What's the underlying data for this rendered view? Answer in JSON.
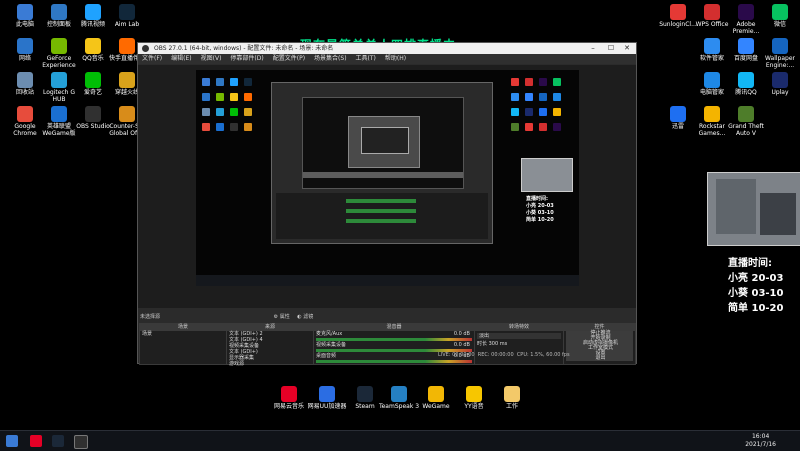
{
  "desktop_left": [
    {
      "label": "此电脑",
      "color": "#3a7bd5",
      "col": 0,
      "row": 0
    },
    {
      "label": "控制面板",
      "color": "#2f78c4",
      "col": 1,
      "row": 0
    },
    {
      "label": "腾讯视频",
      "color": "#1fa2ff",
      "col": 2,
      "row": 0
    },
    {
      "label": "Aim Lab",
      "color": "#11273a",
      "col": 3,
      "row": 0
    },
    {
      "label": "网络",
      "color": "#2a74c9",
      "col": 0,
      "row": 1
    },
    {
      "label": "GeForce Experience",
      "color": "#76b900",
      "col": 1,
      "row": 1
    },
    {
      "label": "QQ音乐",
      "color": "#f5c518",
      "col": 2,
      "row": 1
    },
    {
      "label": "快手直播伴侣",
      "color": "#ff6a00",
      "col": 3,
      "row": 1
    },
    {
      "label": "回收站",
      "color": "#6c8db0",
      "col": 0,
      "row": 2
    },
    {
      "label": "Logitech G HUB",
      "color": "#24a0d8",
      "col": 1,
      "row": 2
    },
    {
      "label": "爱奇艺",
      "color": "#00be06",
      "col": 2,
      "row": 2
    },
    {
      "label": "穿越火线",
      "color": "#d9a21b",
      "col": 3,
      "row": 2
    },
    {
      "label": "Google Chrome",
      "color": "#e74c3c",
      "col": 0,
      "row": 3
    },
    {
      "label": "英雄联盟WeGame版",
      "color": "#1a6fd1",
      "col": 1,
      "row": 3
    },
    {
      "label": "OBS Studio",
      "color": "#303030",
      "col": 2,
      "row": 3
    },
    {
      "label": "Counter-S... Global Off...",
      "color": "#d88c1a",
      "col": 3,
      "row": 3
    }
  ],
  "desktop_right": [
    {
      "label": "SunloginCl...",
      "color": "#e53935",
      "col": 0,
      "row": 0
    },
    {
      "label": "WPS Office",
      "color": "#d32f2f",
      "col": 1,
      "row": 0
    },
    {
      "label": "Adobe Premie...",
      "color": "#2a0a4a",
      "col": 2,
      "row": 0
    },
    {
      "label": "微信",
      "color": "#07c160",
      "col": 3,
      "row": 0
    },
    {
      "label": "软件管家",
      "color": "#2d8cf0",
      "col": 1,
      "row": 1
    },
    {
      "label": "百度网盘",
      "color": "#3385ff",
      "col": 2,
      "row": 1
    },
    {
      "label": "Wallpaper Engine:...",
      "color": "#1565c0",
      "col": 3,
      "row": 1
    },
    {
      "label": "电脑管家",
      "color": "#1e88e5",
      "col": 1,
      "row": 2
    },
    {
      "label": "腾讯QQ",
      "color": "#12b7f5",
      "col": 2,
      "row": 2
    },
    {
      "label": "Uplay",
      "color": "#1a2a6c",
      "col": 3,
      "row": 2
    },
    {
      "label": "迅雷",
      "color": "#1e6ff1",
      "col": 0,
      "row": 3
    },
    {
      "label": "Rockstar Games...",
      "color": "#f4b400",
      "col": 1,
      "row": 3
    },
    {
      "label": "Grand Theft Auto V",
      "color": "#4e7d2a",
      "col": 2,
      "row": 3
    }
  ],
  "desktop_bottom": [
    {
      "label": "网易云音乐",
      "color": "#e60026"
    },
    {
      "label": "网易UU加速器",
      "color": "#2b6de3"
    },
    {
      "label": "Steam",
      "color": "#1b2838"
    },
    {
      "label": "TeamSpeak 3",
      "color": "#2580c3"
    },
    {
      "label": "WeGame",
      "color": "#f2b705"
    },
    {
      "label": "YY语音",
      "color": "#f7c600"
    },
    {
      "label": "工作",
      "color": "#f3c969"
    }
  ],
  "stream_title": "现在是简单单人四排直播中",
  "obs": {
    "title": "OBS 27.0.1 (64-bit, windows) - 配置文件: 未命名 - 场景: 未命名",
    "menu": [
      "文件(F)",
      "编辑(E)",
      "视图(V)",
      "停靠部件(D)",
      "配置文件(P)",
      "场景集合(S)",
      "工具(T)",
      "帮助(H)"
    ],
    "scene_bar_label": "未选择源",
    "scene_bar_props": "属性",
    "scene_bar_filters": "滤镜",
    "panels": {
      "scenes": {
        "title": "场景",
        "items": [
          "场景"
        ]
      },
      "sources": {
        "title": "来源",
        "items": [
          "文本 (GDI+) 2",
          "文本 (GDI+) 4",
          "视频采集设备",
          "文本 (GDI+)",
          "显示器采集",
          "游戏源"
        ]
      },
      "mixer": {
        "title": "混音器",
        "tracks": [
          {
            "name": "麦克风/Aux",
            "db": "0.0 dB"
          },
          {
            "name": "视频采集设备",
            "db": "0.0 dB"
          },
          {
            "name": "桌面音频",
            "db": "0.0 dB"
          }
        ]
      },
      "transitions": {
        "title": "转场特效",
        "type": "淡出",
        "duration_label": "时长",
        "duration": "300 ms"
      },
      "controls": {
        "title": "控件",
        "buttons": [
          "停止推流",
          "开始录制",
          "启动虚拟摄像机",
          "工作室模式",
          "设置",
          "退出"
        ]
      }
    },
    "status": {
      "live": "LIVE: 00:00:00",
      "rec": "REC: 00:00:00",
      "cpu": "CPU: 1.5%, 60.00 fps"
    }
  },
  "schedule": {
    "title": "直播时间:",
    "lines": [
      "小亮 20-03",
      "小葵 03-10",
      "简单 10-20"
    ]
  },
  "clock": {
    "time": "16:04",
    "date": "2021/7/16"
  }
}
